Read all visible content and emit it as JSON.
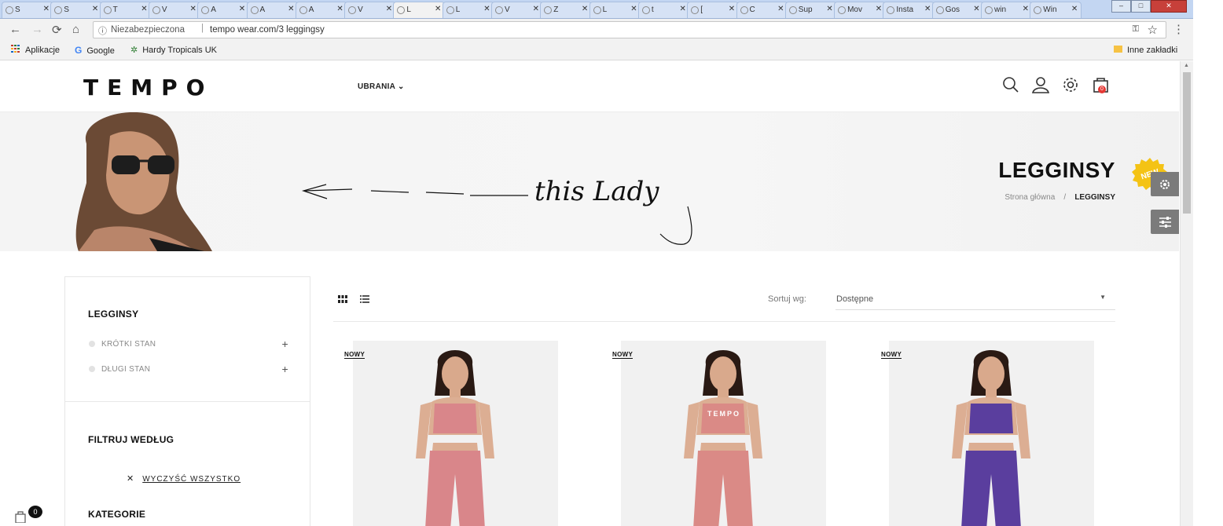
{
  "browser": {
    "tabs": [
      {
        "label": "S",
        "icon": "gmail-icon"
      },
      {
        "label": "S",
        "icon": "site-icon"
      },
      {
        "label": "T",
        "icon": "site-icon"
      },
      {
        "label": "V",
        "icon": "site-icon"
      },
      {
        "label": "A",
        "icon": "site-icon"
      },
      {
        "label": "A",
        "icon": "chat-icon"
      },
      {
        "label": "A",
        "icon": "site-icon"
      },
      {
        "label": "V",
        "icon": "site-icon"
      },
      {
        "label": "L",
        "icon": "site-icon"
      },
      {
        "label": "L",
        "icon": "site-icon"
      },
      {
        "label": "V",
        "icon": "site-icon"
      },
      {
        "label": "Z",
        "icon": "site-icon"
      },
      {
        "label": "L",
        "icon": "site-icon"
      },
      {
        "label": "t",
        "icon": "site-icon"
      },
      {
        "label": "[",
        "icon": "r-icon"
      },
      {
        "label": "C",
        "icon": "n-icon"
      },
      {
        "label": "Sup",
        "icon": "site-icon"
      },
      {
        "label": "Mov",
        "icon": "doc-icon"
      },
      {
        "label": "Insta",
        "icon": "instagram-icon"
      },
      {
        "label": "Gos",
        "icon": "facebook-icon"
      },
      {
        "label": "win",
        "icon": "google-icon"
      },
      {
        "label": "Win",
        "icon": "site-icon"
      }
    ],
    "active_tab_index": 8,
    "security_label": "Niezabezpieczona",
    "url": "tempo wear.com/3 leggingsy",
    "bookmarks": [
      {
        "label": "Aplikacje",
        "icon": "apps-grid-icon"
      },
      {
        "label": "Google",
        "icon": "google-icon"
      },
      {
        "label": "Hardy Tropicals UK",
        "icon": "palm-icon"
      }
    ],
    "other_bookmarks": "Inne zakładki"
  },
  "site": {
    "logo": "TEMPO",
    "nav": {
      "menu_label": "UBRANIA"
    },
    "cart_count": "0"
  },
  "hero": {
    "title": "LEGGINSY",
    "breadcrumb_home": "Strona główna",
    "breadcrumb_sep": "/",
    "breadcrumb_current": "LEGGINSY",
    "annotation_text": "this Lady"
  },
  "side_badge": "NEW",
  "sidebar": {
    "category_title": "LEGGINSY",
    "categories": [
      {
        "label": "KRÓTKI STAN"
      },
      {
        "label": "DŁUGI STAN"
      }
    ],
    "filter_title": "FILTRUJ WEDŁUG",
    "clear_all": "WYCZYŚĆ WSZYSTKO",
    "categories_title": "KATEGORIE"
  },
  "listing": {
    "sort_label": "Sortuj wg:",
    "sort_value": "Dostępne",
    "products": [
      {
        "tag": "NOWY",
        "color": "#d9868a",
        "top_logo": ""
      },
      {
        "tag": "NOWY",
        "color": "#da8a86",
        "top_logo": "TEMPO"
      },
      {
        "tag": "NOWY",
        "color": "#5a3e9e",
        "top_logo": ""
      }
    ]
  },
  "mini_cart": {
    "count": "0"
  }
}
